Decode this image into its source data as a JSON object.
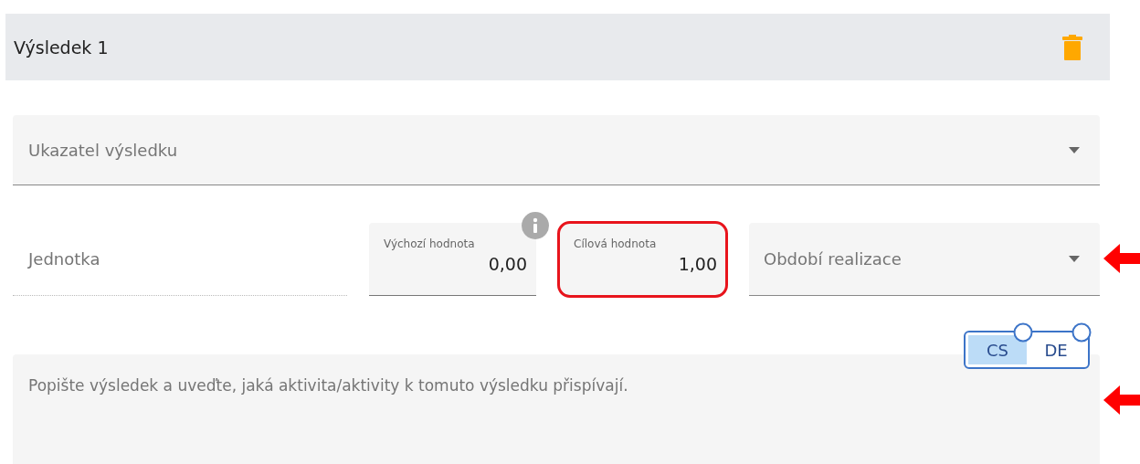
{
  "section": {
    "title": "Výsledek 1"
  },
  "indicator_select": {
    "placeholder": "Ukazatel výsledku"
  },
  "row_fields": [
    {
      "kind": "text",
      "placeholder": "Jednotka"
    },
    {
      "kind": "number",
      "label": "Výchozí hodnota",
      "value": "0,00",
      "info": true,
      "highlighted": false
    },
    {
      "kind": "number",
      "label": "Cílová hodnota",
      "value": "1,00",
      "info": false,
      "highlighted": true
    },
    {
      "kind": "select",
      "placeholder": "Období realizace"
    }
  ],
  "languages": [
    {
      "label": "CS",
      "selected": true
    },
    {
      "label": "DE",
      "selected": false
    }
  ],
  "description": {
    "placeholder": "Popište výsledek a uveďte, jaká aktivita/aktivity k tomuto výsledku přispívají."
  }
}
